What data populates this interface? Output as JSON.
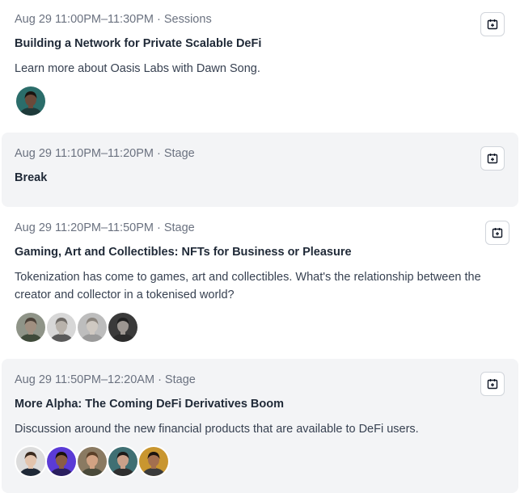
{
  "sessions": [
    {
      "meta": "Aug 29 11:00PM–11:30PM · Sessions",
      "title": "Building a Network for Private Scalable DeFi",
      "description": "Learn more about Oasis Labs with Dawn Song.",
      "calendar_icon": "calendar-add-icon",
      "avatars": [
        {
          "bg": "#2b6d6a",
          "skin": "#6b4a3a",
          "hair": "#1a1410",
          "shirt": "#1e3a3a"
        }
      ]
    },
    {
      "meta": "Aug 29 11:10PM–11:20PM · Stage",
      "title": "Break",
      "description": "",
      "calendar_icon": "calendar-add-icon",
      "avatars": []
    },
    {
      "meta": "Aug 29 11:20PM–11:50PM · Stage",
      "title": "Gaming, Art and Collectibles: NFTs for Business or Pleasure",
      "description": "Tokenization has come to games, art and collectibles. What's the relationship between the creator and collector in a tokenised world?",
      "calendar_icon": "calendar-add-icon",
      "avatars": [
        {
          "bg": "#8f9488",
          "skin": "#a08f80",
          "hair": "#4a4037",
          "shirt": "#3f4a3a"
        },
        {
          "bg": "#d7d7d7",
          "skin": "#b8b2ab",
          "hair": "#6e6a66",
          "shirt": "#5a5a5a"
        },
        {
          "bg": "#bdbdbd",
          "skin": "#cfc9c2",
          "hair": "#8a847d",
          "shirt": "#9a9a9a"
        },
        {
          "bg": "#3a3a3a",
          "skin": "#9c9691",
          "hair": "#1f1f1f",
          "shirt": "#2b2b2b"
        }
      ]
    },
    {
      "meta": "Aug 29 11:50PM–12:20AM · Stage",
      "title": "More Alpha: The Coming DeFi Derivatives Boom",
      "description": "Discussion around the new financial products that are available to DeFi users.",
      "calendar_icon": "calendar-add-icon",
      "avatars": [
        {
          "bg": "#dcdcdc",
          "skin": "#e3c4ad",
          "hair": "#3a2a1e",
          "shirt": "#1f2937"
        },
        {
          "bg": "#5b3bd6",
          "skin": "#8a5d45",
          "hair": "#1a120d",
          "shirt": "#2a1f5f"
        },
        {
          "bg": "#8a7a62",
          "skin": "#d1a283",
          "hair": "#5a3f28",
          "shirt": "#4a4a3a"
        },
        {
          "bg": "#3f6f73",
          "skin": "#caa089",
          "hair": "#1d1a18",
          "shirt": "#2f2f2f"
        },
        {
          "bg": "#c9962f",
          "skin": "#a36f4f",
          "hair": "#1d150f",
          "shirt": "#3b3b3b"
        }
      ]
    }
  ]
}
